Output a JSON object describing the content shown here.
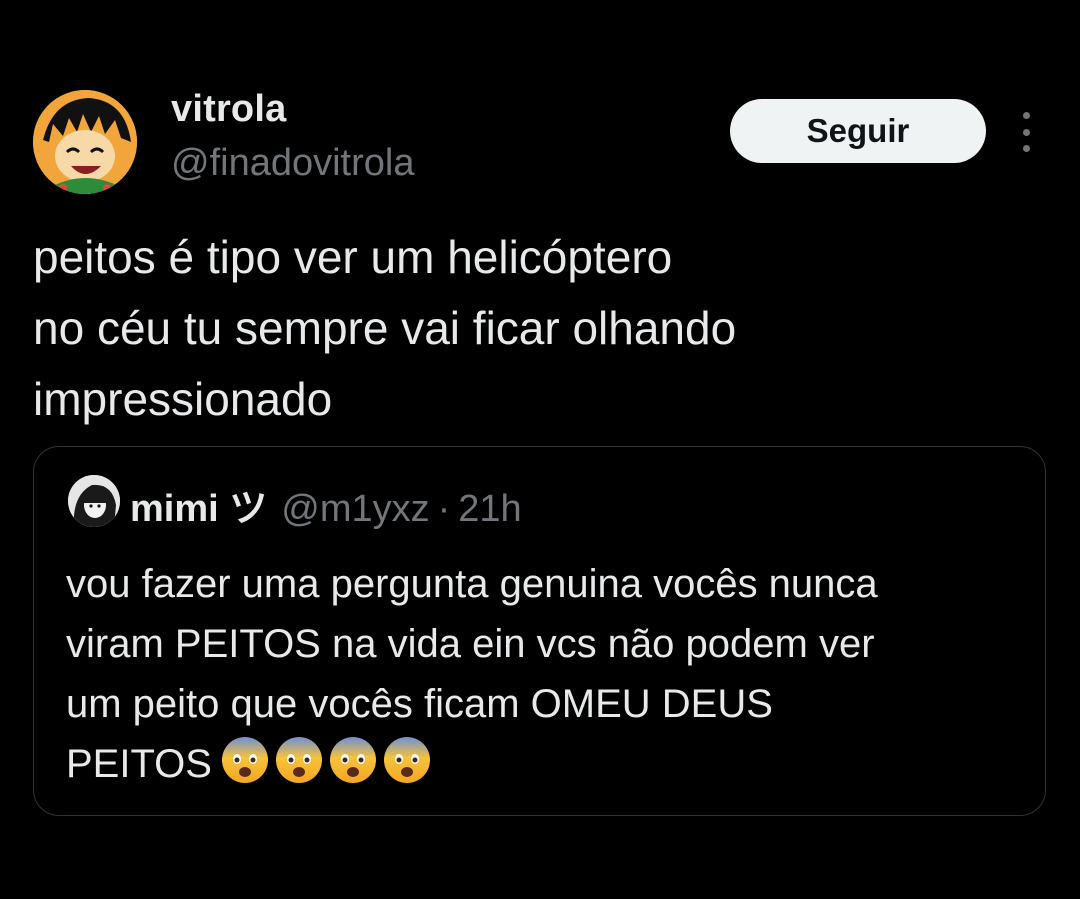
{
  "author": {
    "name": "vitrola",
    "handle": "@finadovitrola",
    "avatar_icon": "cartoon-avatar-icon"
  },
  "follow_button": {
    "label": "Seguir"
  },
  "more_menu": {
    "icon": "more-vertical-icon"
  },
  "tweet": {
    "lines": [
      "peitos é tipo ver um helicóptero",
      "no céu tu sempre vai ficar olhando",
      "impressionado"
    ]
  },
  "quoted_tweet": {
    "name": "mimi ツ",
    "handle": "@m1yxz",
    "separator": "·",
    "time": "21h",
    "avatar_icon": "user-avatar-icon",
    "lines": [
      "vou fazer uma pergunta genuina vocês nunca",
      "viram PEITOS na vida ein vcs não podem ver",
      "um peito que vocês ficam OMEU DEUS",
      "PEITOS"
    ],
    "emoji_icons": [
      "fearful-face-emoji",
      "fearful-face-emoji",
      "fearful-face-emoji",
      "fearful-face-emoji"
    ]
  },
  "colors": {
    "background": "#000000",
    "primary_text": "#e7e9ea",
    "secondary_text": "#71767b",
    "button_bg": "#eff3f4",
    "border": "#2f3336"
  }
}
